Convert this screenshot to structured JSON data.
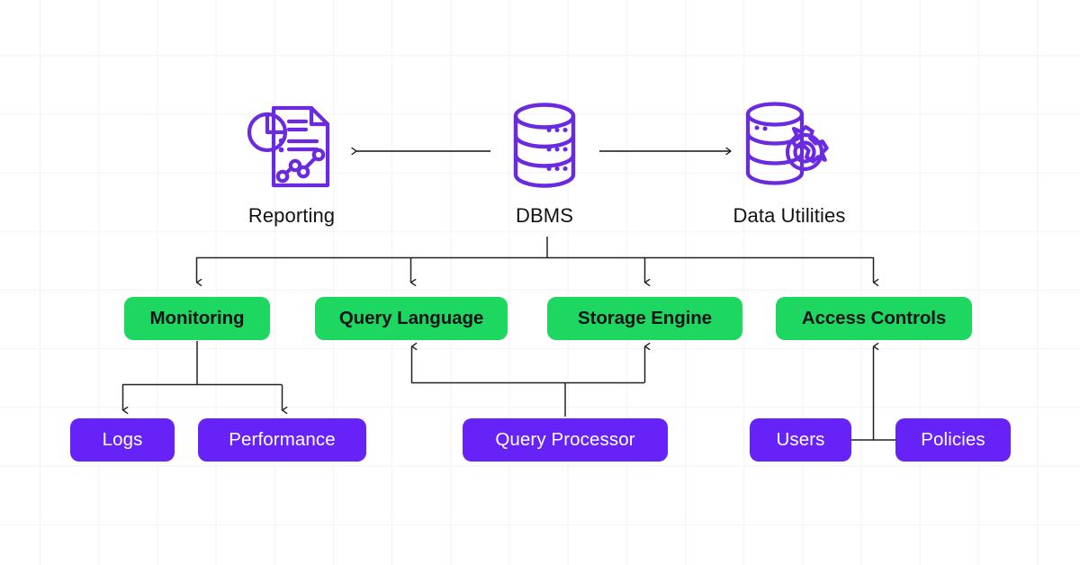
{
  "diagram": {
    "title": "DBMS architecture diagram",
    "colors": {
      "accent_purple": "#6622f7",
      "accent_green": "#1ed760",
      "icon_purple": "#6a2ae0",
      "connector": "#222222",
      "grid": "#f2f2f4",
      "background": "#ffffff",
      "green_text": "#111318",
      "purple_text": "#ffffff"
    },
    "top_nodes": [
      {
        "id": "reporting",
        "label": "Reporting",
        "icon": "report-document-chart-icon"
      },
      {
        "id": "dbms",
        "label": "DBMS",
        "icon": "database-cylinder-icon"
      },
      {
        "id": "data-utilities",
        "label": "Data Utilities",
        "icon": "database-gear-icon"
      }
    ],
    "components": [
      {
        "id": "monitoring",
        "label": "Monitoring"
      },
      {
        "id": "query-language",
        "label": "Query Language"
      },
      {
        "id": "storage-engine",
        "label": "Storage Engine"
      },
      {
        "id": "access-controls",
        "label": "Access Controls"
      }
    ],
    "subcomponents": [
      {
        "id": "logs",
        "label": "Logs"
      },
      {
        "id": "performance",
        "label": "Performance"
      },
      {
        "id": "query-processor",
        "label": "Query Processor"
      },
      {
        "id": "users",
        "label": "Users"
      },
      {
        "id": "policies",
        "label": "Policies"
      }
    ],
    "connections": [
      {
        "from": "dbms",
        "to": "reporting",
        "style": "arrow-left"
      },
      {
        "from": "dbms",
        "to": "data-utilities",
        "style": "arrow-right"
      },
      {
        "from": "dbms",
        "to": "monitoring",
        "style": "arrow-down"
      },
      {
        "from": "dbms",
        "to": "query-language",
        "style": "arrow-down"
      },
      {
        "from": "dbms",
        "to": "storage-engine",
        "style": "arrow-down"
      },
      {
        "from": "dbms",
        "to": "access-controls",
        "style": "arrow-down"
      },
      {
        "from": "monitoring",
        "to": "logs",
        "style": "arrow-down"
      },
      {
        "from": "monitoring",
        "to": "performance",
        "style": "arrow-down"
      },
      {
        "from": "query-processor",
        "to": "query-language",
        "style": "arrow-up"
      },
      {
        "from": "query-processor",
        "to": "storage-engine",
        "style": "arrow-up"
      },
      {
        "from": "users",
        "to": "access-controls",
        "style": "arrow-up"
      },
      {
        "from": "policies",
        "to": "access-controls",
        "style": "arrow-up"
      }
    ]
  }
}
